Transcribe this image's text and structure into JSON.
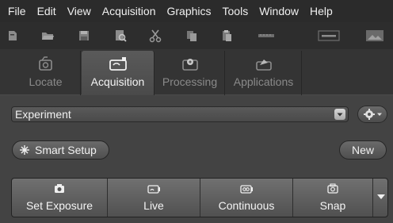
{
  "menubar": {
    "items": [
      "File",
      "Edit",
      "View",
      "Acquisition",
      "Graphics",
      "Tools",
      "Window",
      "Help"
    ]
  },
  "toolbar": {
    "icons": [
      "new-document-icon",
      "open-folder-icon",
      "save-icon",
      "print-preview-icon",
      "cut-icon",
      "copy-icon",
      "paste-icon",
      "ruler-icon",
      "scale-bar-icon",
      "image-icon"
    ]
  },
  "tabs": [
    {
      "label": "Locate",
      "icon": "eyepiece-icon",
      "active": false
    },
    {
      "label": "Acquisition",
      "icon": "camera-acquire-icon",
      "active": true
    },
    {
      "label": "Processing",
      "icon": "gear-processing-icon",
      "active": false
    },
    {
      "label": "Applications",
      "icon": "applications-icon",
      "active": false
    }
  ],
  "experiment": {
    "value": "Experiment"
  },
  "buttons": {
    "smart_setup": "Smart Setup",
    "new": "New"
  },
  "actions": [
    {
      "label": "Set Exposure",
      "icon": "camera-icon"
    },
    {
      "label": "Live",
      "icon": "live-icon"
    },
    {
      "label": "Continuous",
      "icon": "continuous-icon"
    },
    {
      "label": "Snap",
      "icon": "snap-camera-icon"
    }
  ],
  "colors": {
    "background": "#3e3e3e",
    "menubar": "#2b2b2b",
    "panel": "#434343",
    "active_tab_text": "#f4f4f4",
    "inactive_tab_text": "#8a8a8a"
  }
}
